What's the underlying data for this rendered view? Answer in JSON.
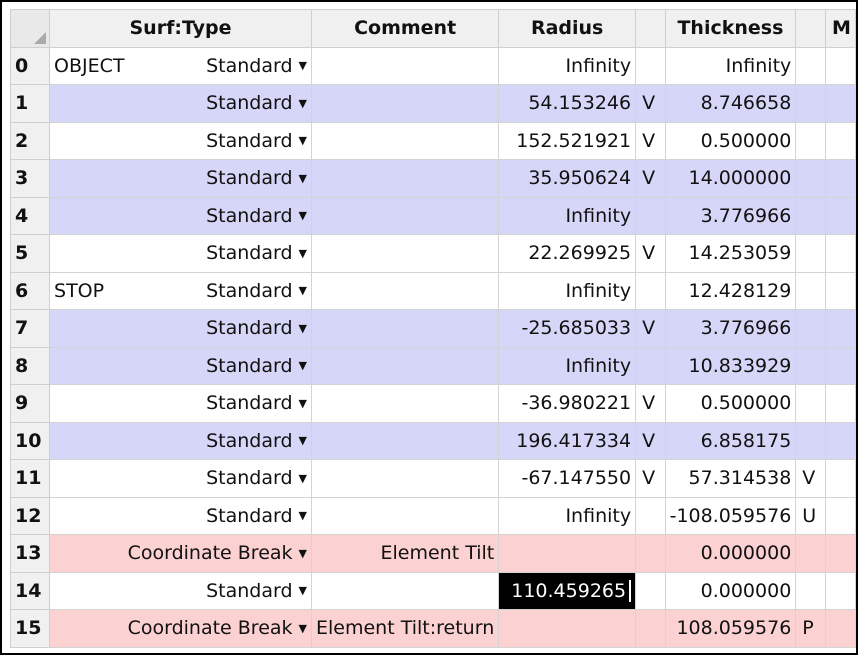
{
  "headers": {
    "type": "Surf:Type",
    "comment": "Comment",
    "radius": "Radius",
    "thickness": "Thickness",
    "partial": "M"
  },
  "editing_row": 14,
  "rows": [
    {
      "num": "0",
      "label": "OBJECT",
      "type": "Standard",
      "comment": "",
      "radius": "Infinity",
      "radius_solve": "",
      "thickness": "Infinity",
      "thickness_solve": "",
      "color": "white"
    },
    {
      "num": "1",
      "label": "",
      "type": "Standard",
      "comment": "",
      "radius": "54.153246",
      "radius_solve": "V",
      "thickness": "8.746658",
      "thickness_solve": "",
      "color": "blue"
    },
    {
      "num": "2",
      "label": "",
      "type": "Standard",
      "comment": "",
      "radius": "152.521921",
      "radius_solve": "V",
      "thickness": "0.500000",
      "thickness_solve": "",
      "color": "white"
    },
    {
      "num": "3",
      "label": "",
      "type": "Standard",
      "comment": "",
      "radius": "35.950624",
      "radius_solve": "V",
      "thickness": "14.000000",
      "thickness_solve": "",
      "color": "blue"
    },
    {
      "num": "4",
      "label": "",
      "type": "Standard",
      "comment": "",
      "radius": "Infinity",
      "radius_solve": "",
      "thickness": "3.776966",
      "thickness_solve": "",
      "color": "blue"
    },
    {
      "num": "5",
      "label": "",
      "type": "Standard",
      "comment": "",
      "radius": "22.269925",
      "radius_solve": "V",
      "thickness": "14.253059",
      "thickness_solve": "",
      "color": "white"
    },
    {
      "num": "6",
      "label": "STOP",
      "type": "Standard",
      "comment": "",
      "radius": "Infinity",
      "radius_solve": "",
      "thickness": "12.428129",
      "thickness_solve": "",
      "color": "white"
    },
    {
      "num": "7",
      "label": "",
      "type": "Standard",
      "comment": "",
      "radius": "-25.685033",
      "radius_solve": "V",
      "thickness": "3.776966",
      "thickness_solve": "",
      "color": "blue"
    },
    {
      "num": "8",
      "label": "",
      "type": "Standard",
      "comment": "",
      "radius": "Infinity",
      "radius_solve": "",
      "thickness": "10.833929",
      "thickness_solve": "",
      "color": "blue"
    },
    {
      "num": "9",
      "label": "",
      "type": "Standard",
      "comment": "",
      "radius": "-36.980221",
      "radius_solve": "V",
      "thickness": "0.500000",
      "thickness_solve": "",
      "color": "white"
    },
    {
      "num": "10",
      "label": "",
      "type": "Standard",
      "comment": "",
      "radius": "196.417334",
      "radius_solve": "V",
      "thickness": "6.858175",
      "thickness_solve": "",
      "color": "blue"
    },
    {
      "num": "11",
      "label": "",
      "type": "Standard",
      "comment": "",
      "radius": "-67.147550",
      "radius_solve": "V",
      "thickness": "57.314538",
      "thickness_solve": "V",
      "color": "white"
    },
    {
      "num": "12",
      "label": "",
      "type": "Standard",
      "comment": "",
      "radius": "Infinity",
      "radius_solve": "",
      "thickness": "-108.059576",
      "thickness_solve": "U",
      "color": "white"
    },
    {
      "num": "13",
      "label": "",
      "type": "Coordinate Break",
      "comment": "Element Tilt",
      "radius": "",
      "radius_solve": "",
      "thickness": "0.000000",
      "thickness_solve": "",
      "color": "pink"
    },
    {
      "num": "14",
      "label": "",
      "type": "Standard",
      "comment": "",
      "radius": "110.459265",
      "radius_solve": "",
      "thickness": "0.000000",
      "thickness_solve": "",
      "color": "white"
    },
    {
      "num": "15",
      "label": "",
      "type": "Coordinate Break",
      "comment": "Element Tilt:return",
      "radius": "",
      "radius_solve": "",
      "thickness": "108.059576",
      "thickness_solve": "P",
      "color": "pink"
    }
  ]
}
